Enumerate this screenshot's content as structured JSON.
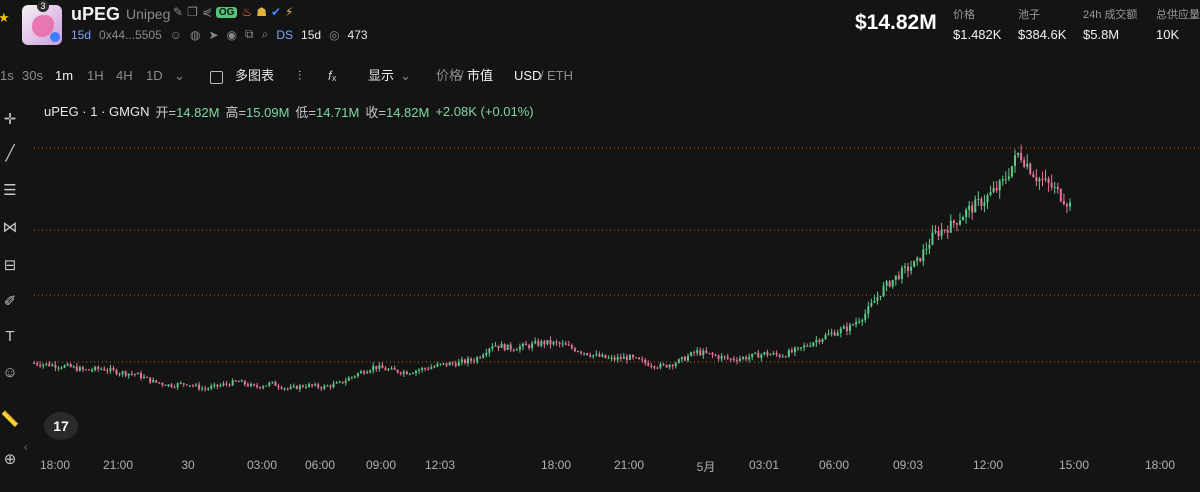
{
  "header": {
    "token_symbol": "uPEG",
    "token_name": "Unipeg",
    "badge_count": "3",
    "og_badge": "OG",
    "age": "15d",
    "contract": "0x44...5505",
    "ds_label": "DS",
    "ds_age": "15d",
    "views": "473",
    "market_cap": "$14.82M",
    "stats": [
      {
        "label": "价格",
        "value": "$1.482K"
      },
      {
        "label": "池子",
        "value": "$384.6K"
      },
      {
        "label": "24h 成交额",
        "value": "$5.8M"
      },
      {
        "label": "总供应量",
        "value": "10K"
      }
    ]
  },
  "toolbar": {
    "intervals": [
      "1s",
      "30s",
      "1m",
      "1H",
      "4H",
      "1D"
    ],
    "active_interval": "1m",
    "multi_chart": "多图表",
    "display": "显示",
    "price_label": "价格",
    "mcap_label": "市值",
    "currency_usd": "USD",
    "currency_eth": "ETH"
  },
  "legend": {
    "title": "uPEG · 1 · GMGN",
    "open_label": "开=",
    "open": "14.82M",
    "high_label": "高=",
    "high": "15.09M",
    "low_label": "低=",
    "low": "14.71M",
    "close_label": "收=",
    "close": "14.82M",
    "change": "+2.08K (+0.01%)"
  },
  "tv_logo": "17",
  "chart_data": {
    "type": "candlestick-line",
    "x_ticks": [
      "18:00",
      "21:00",
      "30",
      "03:00",
      "06:00",
      "09:00",
      "12:03",
      "18:00",
      "21:00",
      "5月",
      "03:01",
      "06:00",
      "09:03",
      "12:00",
      "15:00",
      "18:00"
    ],
    "y_unit": "market cap (USD)",
    "y_range": [
      0,
      15.3
    ],
    "series": [
      {
        "values": [
          3.6,
          3.5,
          3.4,
          3.2,
          3.3,
          3.1,
          3.0,
          2.6,
          2.4,
          2.5,
          2.2,
          2.4,
          2.6,
          2.3,
          2.5,
          2.2,
          2.4,
          2.3,
          2.5,
          3.0,
          3.4,
          3.2,
          3.1,
          3.3,
          3.5,
          3.6,
          3.8,
          4.6,
          4.4,
          4.5,
          4.7,
          4.6,
          4.3,
          4.0,
          3.8,
          3.9,
          3.6,
          3.4,
          3.7,
          4.2,
          4.0,
          3.8,
          3.9,
          4.1,
          4.0,
          4.3,
          4.8,
          5.2,
          5.5,
          6.3,
          7.6,
          8.4,
          9.0,
          10.5,
          11.0,
          11.8,
          12.4,
          13.2,
          14.9,
          13.6,
          13.0,
          12.1
        ]
      }
    ],
    "colors": {
      "up": "#5fc98a",
      "down": "#e8739a",
      "line": "#e6e6e6"
    },
    "hlines_color": "#b86a2a"
  }
}
